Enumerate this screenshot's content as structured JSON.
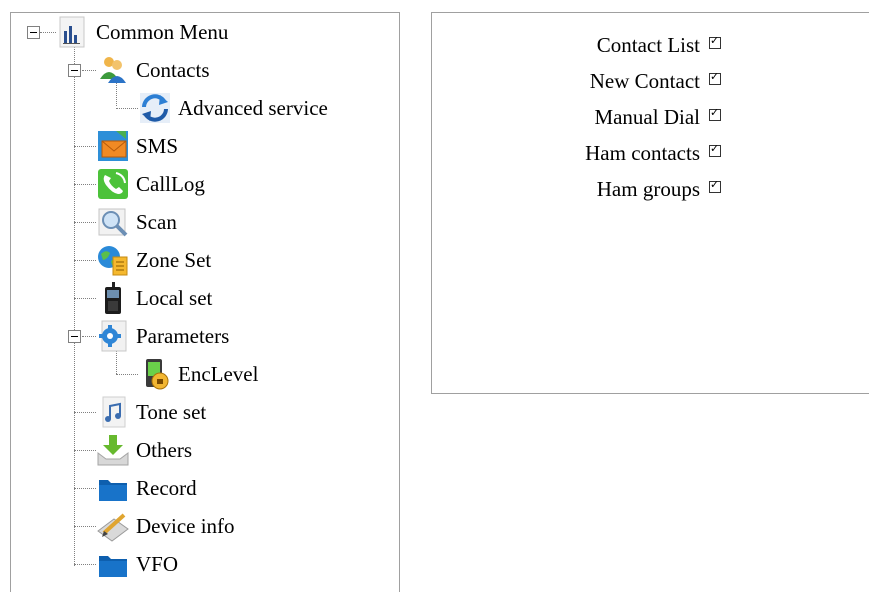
{
  "tree": {
    "root": {
      "label": "Common Menu",
      "icon": "chart-doc-icon"
    },
    "items": [
      {
        "label": "Contacts",
        "icon": "contacts-icon"
      },
      {
        "label": "Advanced service",
        "icon": "sync-icon"
      },
      {
        "label": "SMS",
        "icon": "sms-envelope-icon"
      },
      {
        "label": "CallLog",
        "icon": "phone-call-icon"
      },
      {
        "label": "Scan",
        "icon": "scan-magnifier-icon"
      },
      {
        "label": "Zone Set",
        "icon": "globe-doc-icon"
      },
      {
        "label": "Local set",
        "icon": "radio-device-icon"
      },
      {
        "label": "Parameters",
        "icon": "gear-doc-icon"
      },
      {
        "label": "EncLevel",
        "icon": "lock-device-icon"
      },
      {
        "label": "Tone set",
        "icon": "music-note-icon"
      },
      {
        "label": "Others",
        "icon": "download-tray-icon"
      },
      {
        "label": "Record",
        "icon": "folder-icon"
      },
      {
        "label": "Device info",
        "icon": "pencil-card-icon"
      },
      {
        "label": "VFO",
        "icon": "folder-icon"
      }
    ]
  },
  "options": [
    {
      "label": "Contact List",
      "checked": true
    },
    {
      "label": "New Contact",
      "checked": true
    },
    {
      "label": "Manual Dial",
      "checked": true
    },
    {
      "label": "Ham contacts",
      "checked": true
    },
    {
      "label": "Ham groups",
      "checked": true
    }
  ]
}
